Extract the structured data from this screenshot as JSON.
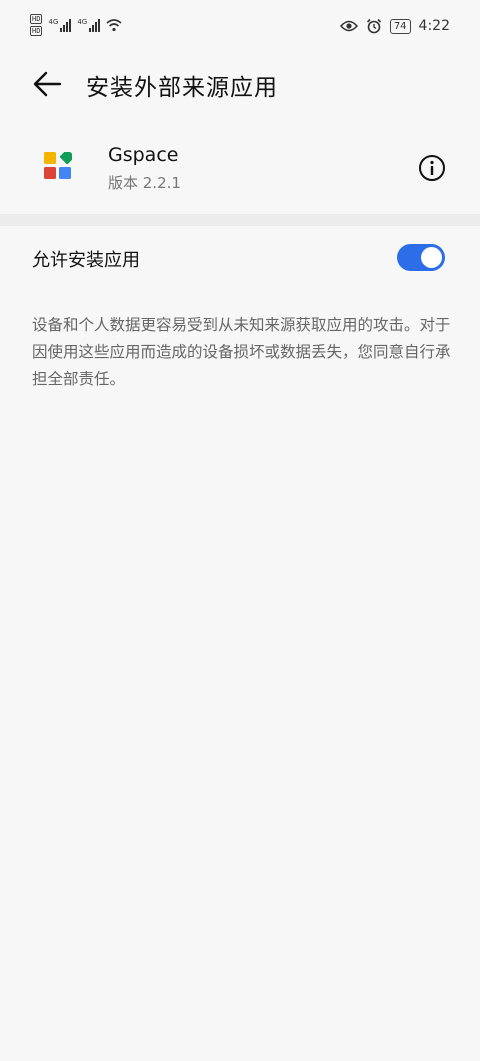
{
  "status_bar": {
    "hd_badge_1": "HD",
    "hd_badge_2": "HD",
    "network_1": "4G",
    "network_2": "4G",
    "battery": "74",
    "time": "4:22"
  },
  "header": {
    "title": "安装外部来源应用"
  },
  "app": {
    "name": "Gspace",
    "version": "版本 2.2.1"
  },
  "setting": {
    "label": "允许安装应用",
    "enabled": true
  },
  "warning_text": "设备和个人数据更容易受到从未知来源获取应用的攻击。对于因使用这些应用而造成的设备损坏或数据丢失，您同意自行承担全部责任。",
  "colors": {
    "accent": "#2b6ee8",
    "background": "#f7f7f7",
    "icon_yellow": "#f4b400",
    "icon_green": "#0f9d58",
    "icon_red": "#db4437",
    "icon_blue": "#4285f4"
  }
}
